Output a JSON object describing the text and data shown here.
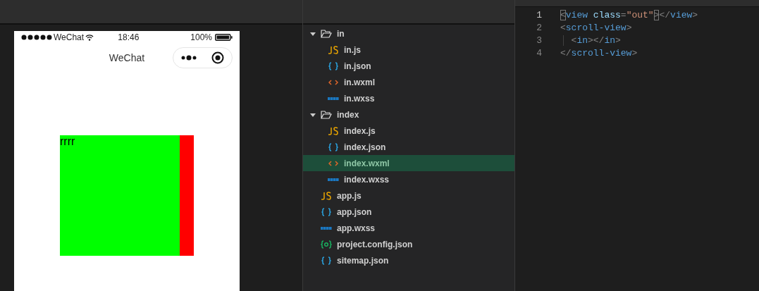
{
  "simulator": {
    "status_bar": {
      "carrier": "WeChat",
      "time": "18:46",
      "battery": "100%"
    },
    "nav_bar": {
      "title": "WeChat"
    },
    "content": {
      "box_text": "rrrr"
    }
  },
  "file_tree": [
    {
      "kind": "folder",
      "label": "in",
      "expanded": true,
      "selected": false,
      "children": [
        {
          "kind": "js",
          "label": "in.js",
          "selected": false
        },
        {
          "kind": "json",
          "label": "in.json",
          "selected": false
        },
        {
          "kind": "wxml",
          "label": "in.wxml",
          "selected": false
        },
        {
          "kind": "wxss",
          "label": "in.wxss",
          "selected": false
        }
      ]
    },
    {
      "kind": "folder",
      "label": "index",
      "expanded": true,
      "selected": false,
      "children": [
        {
          "kind": "js",
          "label": "index.js",
          "selected": false
        },
        {
          "kind": "json",
          "label": "index.json",
          "selected": false
        },
        {
          "kind": "wxml",
          "label": "index.wxml",
          "selected": true
        },
        {
          "kind": "wxss",
          "label": "index.wxss",
          "selected": false
        }
      ]
    },
    {
      "kind": "js",
      "label": "app.js",
      "selected": false
    },
    {
      "kind": "json",
      "label": "app.json",
      "selected": false
    },
    {
      "kind": "wxss",
      "label": "app.wxss",
      "selected": false
    },
    {
      "kind": "config",
      "label": "project.config.json",
      "selected": false
    },
    {
      "kind": "json",
      "label": "sitemap.json",
      "selected": false
    }
  ],
  "editor": {
    "lines": [
      {
        "number": "1",
        "current": true,
        "tokens": [
          {
            "kind": "match",
            "text": "<"
          },
          {
            "kind": "tag",
            "text": "view"
          },
          {
            "kind": "attr",
            "text": "class",
            "space_before": true
          },
          {
            "kind": "punct",
            "text": "="
          },
          {
            "kind": "string",
            "text": "\"out\""
          },
          {
            "kind": "match",
            "text": ">"
          },
          {
            "kind": "punct",
            "text": "</"
          },
          {
            "kind": "tag",
            "text": "view"
          },
          {
            "kind": "punct",
            "text": ">"
          }
        ]
      },
      {
        "number": "2",
        "current": false,
        "tokens": [
          {
            "kind": "punct",
            "text": "<"
          },
          {
            "kind": "tag",
            "text": "scroll-view"
          },
          {
            "kind": "punct",
            "text": ">"
          }
        ]
      },
      {
        "number": "3",
        "current": false,
        "indented": true,
        "tokens": [
          {
            "kind": "punct",
            "text": "<"
          },
          {
            "kind": "tag",
            "text": "in"
          },
          {
            "kind": "punct",
            "text": "></"
          },
          {
            "kind": "tag",
            "text": "in"
          },
          {
            "kind": "punct",
            "text": ">"
          }
        ]
      },
      {
        "number": "4",
        "current": false,
        "tokens": [
          {
            "kind": "punct",
            "text": "</"
          },
          {
            "kind": "tag",
            "text": "scroll-view"
          },
          {
            "kind": "punct",
            "text": ">"
          }
        ]
      }
    ]
  }
}
